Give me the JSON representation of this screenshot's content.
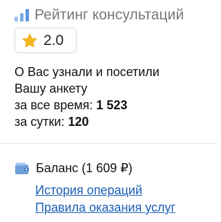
{
  "rating": {
    "title": "Рейтинг консультаций",
    "value": "2.0",
    "icon": "bar-chart-icon",
    "star_icon": "star-icon",
    "star_color": "#f5b71e"
  },
  "stats": {
    "line1": "О Вас узнали и посетили",
    "line2": "Вашу анкету",
    "all_time_label": "за все время: ",
    "all_time_value": "1 523",
    "day_label": "за сутки: ",
    "day_value": "120"
  },
  "balance": {
    "icon": "wallet-icon",
    "label": "Баланс (1 609 ₽)"
  },
  "links": {
    "history": "История операций",
    "rules": "Правила оказания услуг"
  },
  "colors": {
    "link": "#1a5fb4",
    "muted_title": "#777777",
    "accent_blue": "#5b98e0"
  }
}
